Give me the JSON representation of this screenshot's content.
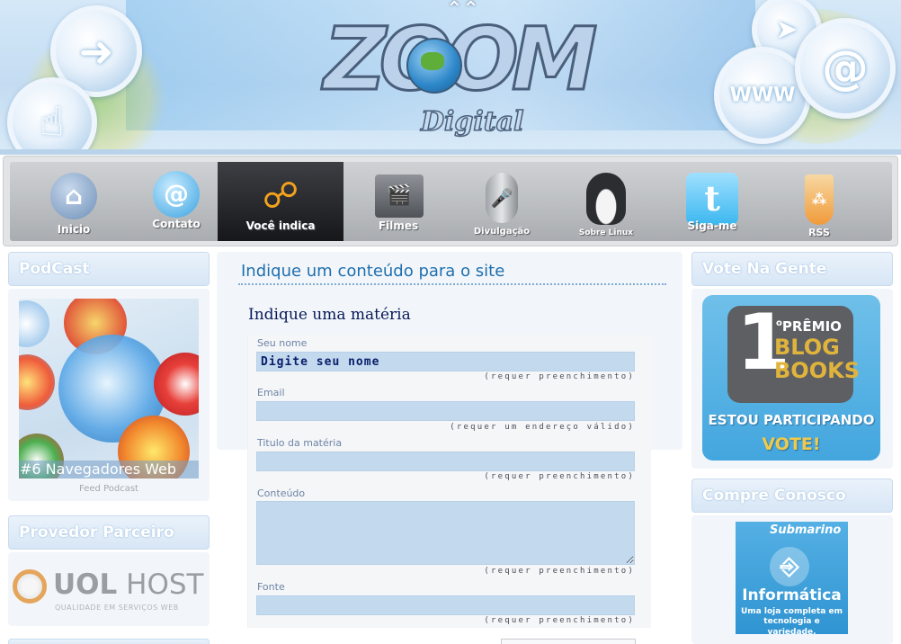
{
  "nav": {
    "items": [
      {
        "label": "Inicio",
        "icon": "home-icon",
        "active": false
      },
      {
        "label": "Contato",
        "icon": "at-icon",
        "active": false
      },
      {
        "label": "Você indica",
        "icon": "link-icon",
        "active": true
      },
      {
        "label": "Filmes",
        "icon": "clapperboard-icon",
        "active": false
      },
      {
        "label": "Divulgação",
        "icon": "microphone-icon",
        "active": false
      },
      {
        "label": "Sobre Linux",
        "icon": "penguin-icon",
        "active": false
      },
      {
        "label": "Siga-me",
        "icon": "twitter-icon",
        "active": false
      },
      {
        "label": "RSS",
        "icon": "rss-icon",
        "active": false
      }
    ]
  },
  "left": {
    "podcast_title": "PodCast",
    "podcast_caption": "#6  Navegadores Web",
    "feed_link": "Feed Podcast",
    "partner_title": "Provedor Parceiro",
    "partner_logo_bold": "UOL",
    "partner_logo_light": "HOST",
    "partner_tagline": "QUALIDADE EM SERVIÇOS WEB"
  },
  "main": {
    "page_title": "Indique um conteúdo para o site",
    "form_heading": "Indique uma matéria",
    "fields": [
      {
        "label": "Seu nome",
        "value": "Digite seu nome",
        "hint": "(requer preenchimento)"
      },
      {
        "label": "Email",
        "value": "",
        "hint": "(requer um endereço válido)"
      },
      {
        "label": "Titulo da matéria",
        "value": "",
        "hint": "(requer preenchimento)"
      },
      {
        "label": "Conteúdo",
        "value": "",
        "hint": "(requer preenchimento)"
      },
      {
        "label": "Fonte",
        "value": "",
        "hint": "(requer preenchimento)"
      }
    ]
  },
  "right": {
    "vote_title": "Vote Na Gente",
    "award_number": "1",
    "award_superscript": "o",
    "award_premio": "PRÊMIO",
    "award_blog": "BLOG",
    "award_books": "BOOKS",
    "award_participando": "ESTOU PARTICIPANDO",
    "award_vote": "VOTE!",
    "shop_title": "Compre Conosco",
    "shop_brand": "Submarino",
    "shop_category": "Informática",
    "shop_desc": "Uma loja completa em tecnologia e variedade."
  },
  "header": {
    "logo_main": "ZOOM",
    "logo_sub": "Digital",
    "bubble_www": "WWW",
    "bubble_at": "@"
  }
}
